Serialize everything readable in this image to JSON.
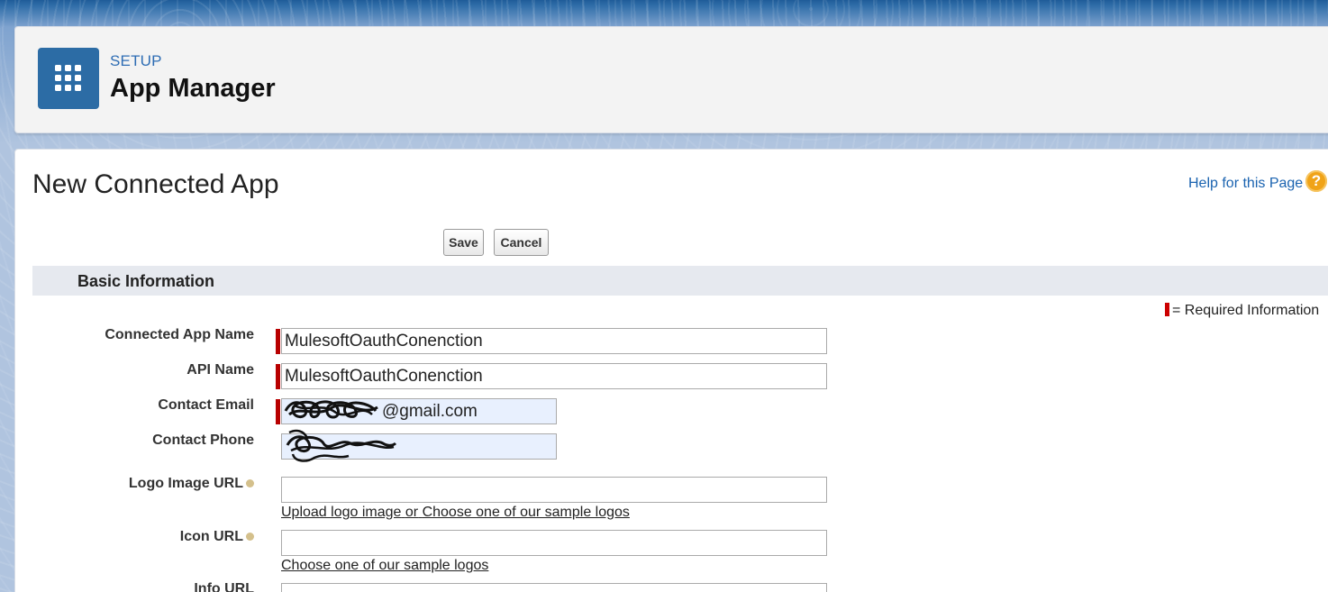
{
  "header": {
    "setup_label": "SETUP",
    "title": "App Manager",
    "icon": "grid-icon"
  },
  "page": {
    "title": "New Connected App",
    "help_link": "Help for this Page",
    "help_icon": "question-icon"
  },
  "buttons": {
    "save": "Save",
    "cancel": "Cancel"
  },
  "section": {
    "title": "Basic Information",
    "required_legend": "= Required Information"
  },
  "form": {
    "connected_app_name": {
      "label": "Connected App Name",
      "value": "MulesoftOauthConenction",
      "required": true
    },
    "api_name": {
      "label": "API Name",
      "value": "MulesoftOauthConenction",
      "required": true
    },
    "contact_email": {
      "label": "Contact Email",
      "value_visible": "@gmail.com",
      "required": true
    },
    "contact_phone": {
      "label": "Contact Phone",
      "value_visible": ""
    },
    "logo_image_url": {
      "label": "Logo Image URL",
      "value": "",
      "upload_link": "Upload logo image",
      "or_text": "or",
      "sample_link": "Choose one of our sample logos"
    },
    "icon_url": {
      "label": "Icon URL",
      "value": "",
      "sample_link": "Choose one of our sample logos"
    },
    "info_url": {
      "label": "Info URL",
      "value": ""
    }
  },
  "colors": {
    "accent_blue": "#2c6ca5",
    "required_red": "#b80000",
    "link_blue": "#1a63b0",
    "help_orange": "#f0a317"
  }
}
